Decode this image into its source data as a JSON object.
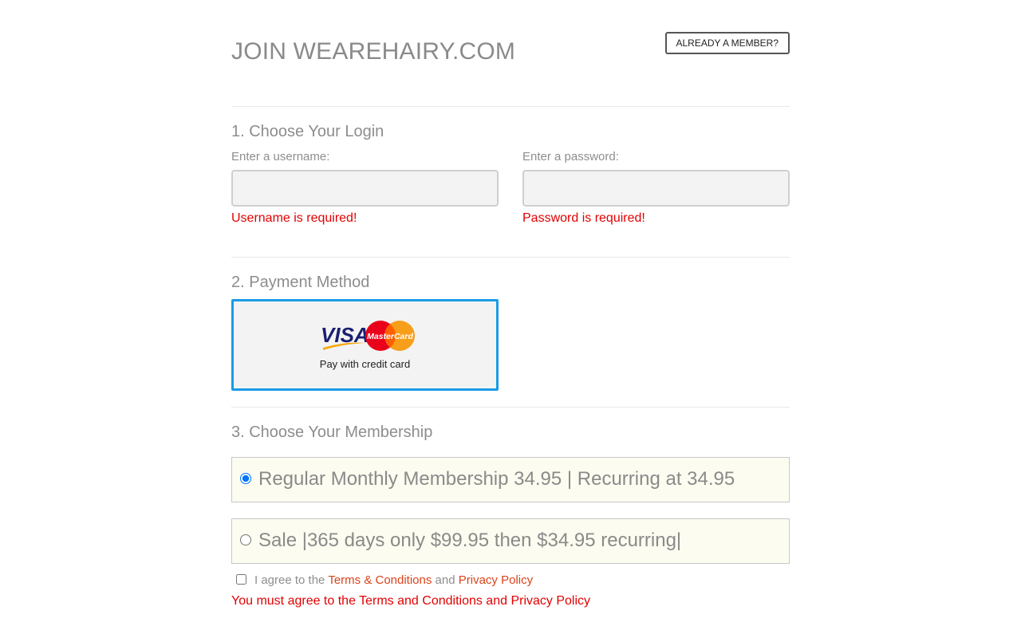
{
  "header": {
    "title": "JOIN WEAREHAIRY.COM",
    "member_button": "ALREADY A MEMBER?"
  },
  "login": {
    "section_title": "1. Choose Your Login",
    "username_label": "Enter a username:",
    "username_value": "",
    "username_error": "Username is required!",
    "password_label": "Enter a password:",
    "password_value": "",
    "password_error": "Password is required!"
  },
  "payment": {
    "section_title": "2. Payment Method",
    "option_label": "Pay with credit card",
    "selected": true,
    "logos": [
      "visa-logo",
      "mastercard-logo"
    ],
    "logo_text": {
      "visa": "VISA",
      "mastercard": "MasterCard"
    },
    "selected_border_color": "#1a9be6"
  },
  "membership": {
    "section_title": "3. Choose Your Membership",
    "plans": [
      {
        "label": "Regular Monthly Membership 34.95 | Recurring at 34.95",
        "selected": true
      },
      {
        "label": "Sale |365 days only $99.95 then $34.95 recurring|",
        "selected": false
      }
    ]
  },
  "agreement": {
    "prefix": "I agree to the",
    "terms_link": "Terms & Conditions",
    "conjunction": "and",
    "privacy_link": "Privacy Policy",
    "checked": false,
    "error": "You must agree to the Terms and Conditions and Privacy Policy"
  },
  "colors": {
    "error": "#e30000",
    "link": "#d9441a",
    "heading": "#8d8d8d",
    "plan_background": "#fcfcf0"
  }
}
